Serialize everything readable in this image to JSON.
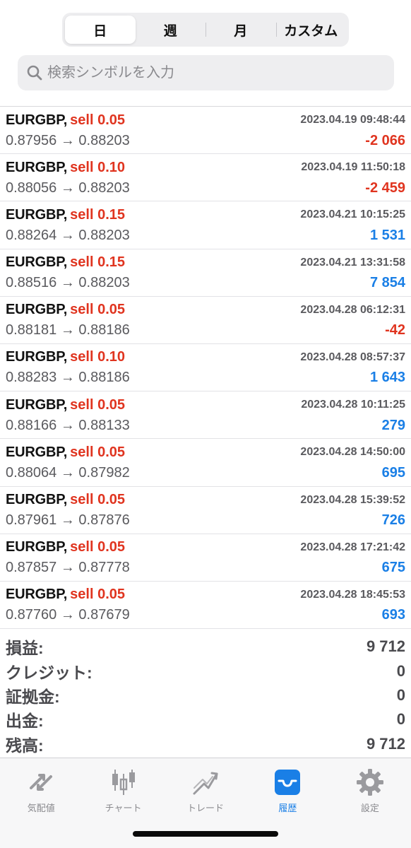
{
  "period_tabs": [
    {
      "label": "日",
      "active": true
    },
    {
      "label": "週",
      "active": false
    },
    {
      "label": "月",
      "active": false
    },
    {
      "label": "カスタム",
      "active": false
    }
  ],
  "search": {
    "placeholder": "検索シンボルを入力",
    "icon": "search-icon"
  },
  "trades": [
    {
      "symbol": "EURGBP,",
      "side": "sell 0.05",
      "time": "2023.04.19 09:48:44",
      "prices": "0.87956 → 0.88203",
      "profit": "-2 066",
      "profit_sign": "neg"
    },
    {
      "symbol": "EURGBP,",
      "side": "sell 0.10",
      "time": "2023.04.19 11:50:18",
      "prices": "0.88056 → 0.88203",
      "profit": "-2 459",
      "profit_sign": "neg"
    },
    {
      "symbol": "EURGBP,",
      "side": "sell 0.15",
      "time": "2023.04.21 10:15:25",
      "prices": "0.88264 → 0.88203",
      "profit": "1 531",
      "profit_sign": "pos"
    },
    {
      "symbol": "EURGBP,",
      "side": "sell 0.15",
      "time": "2023.04.21 13:31:58",
      "prices": "0.88516 → 0.88203",
      "profit": "7 854",
      "profit_sign": "pos"
    },
    {
      "symbol": "EURGBP,",
      "side": "sell 0.05",
      "time": "2023.04.28 06:12:31",
      "prices": "0.88181 → 0.88186",
      "profit": "-42",
      "profit_sign": "neg"
    },
    {
      "symbol": "EURGBP,",
      "side": "sell 0.10",
      "time": "2023.04.28 08:57:37",
      "prices": "0.88283 → 0.88186",
      "profit": "1 643",
      "profit_sign": "pos"
    },
    {
      "symbol": "EURGBP,",
      "side": "sell 0.05",
      "time": "2023.04.28 10:11:25",
      "prices": "0.88166 → 0.88133",
      "profit": "279",
      "profit_sign": "pos"
    },
    {
      "symbol": "EURGBP,",
      "side": "sell 0.05",
      "time": "2023.04.28 14:50:00",
      "prices": "0.88064 → 0.87982",
      "profit": "695",
      "profit_sign": "pos"
    },
    {
      "symbol": "EURGBP,",
      "side": "sell 0.05",
      "time": "2023.04.28 15:39:52",
      "prices": "0.87961 → 0.87876",
      "profit": "726",
      "profit_sign": "pos"
    },
    {
      "symbol": "EURGBP,",
      "side": "sell 0.05",
      "time": "2023.04.28 17:21:42",
      "prices": "0.87857 → 0.87778",
      "profit": "675",
      "profit_sign": "pos"
    },
    {
      "symbol": "EURGBP,",
      "side": "sell 0.05",
      "time": "2023.04.28 18:45:53",
      "prices": "0.87760 → 0.87679",
      "profit": "693",
      "profit_sign": "pos"
    }
  ],
  "summary": [
    {
      "label": "損益:",
      "value": "9 712"
    },
    {
      "label": "クレジット:",
      "value": "0"
    },
    {
      "label": "証拠金:",
      "value": "0"
    },
    {
      "label": "出金:",
      "value": "0"
    },
    {
      "label": "残高:",
      "value": "9 712"
    }
  ],
  "tabbar": [
    {
      "label": "気配値",
      "icon": "quotes-arrows-icon",
      "active": false
    },
    {
      "label": "チャート",
      "icon": "candlestick-chart-icon",
      "active": false
    },
    {
      "label": "トレード",
      "icon": "trade-line-icon",
      "active": false
    },
    {
      "label": "履歴",
      "icon": "history-tray-icon",
      "active": true
    },
    {
      "label": "設定",
      "icon": "gear-icon",
      "active": false
    }
  ],
  "colors": {
    "loss": "#e0341f",
    "profit": "#1a7fe6",
    "active_tab": "#1a7fe6",
    "inactive_tab": "#8a8a8e"
  }
}
